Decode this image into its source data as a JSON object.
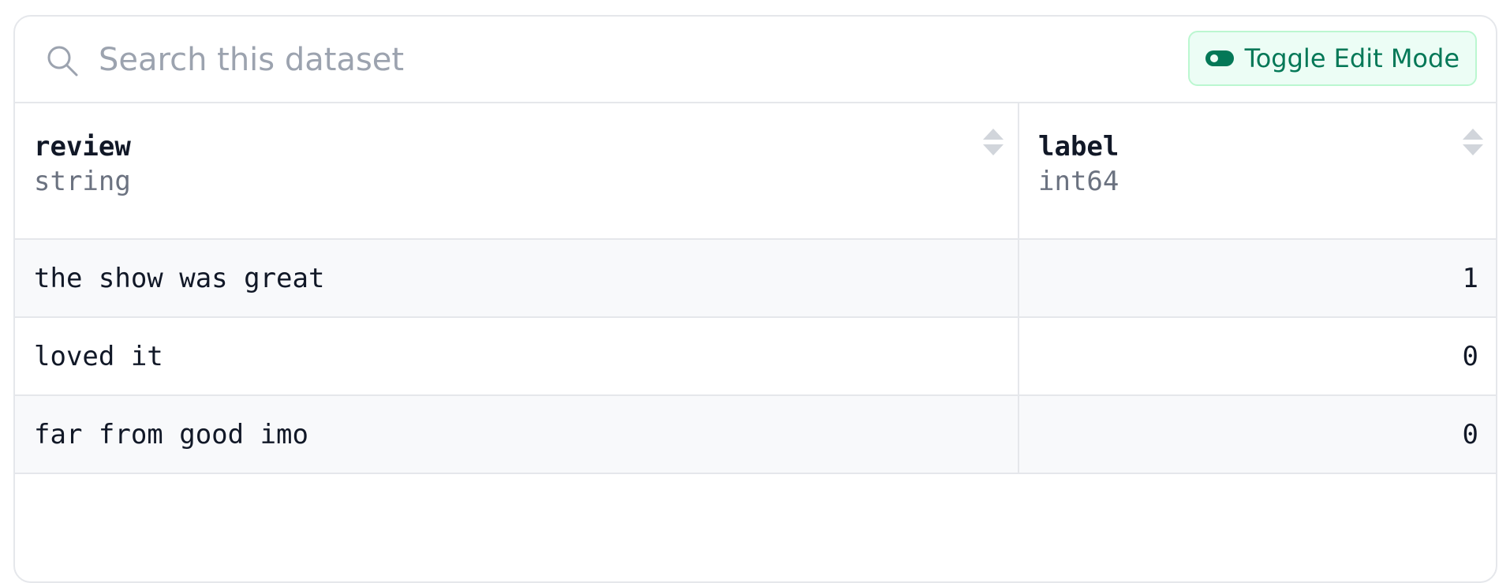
{
  "search": {
    "placeholder": "Search this dataset"
  },
  "toolbar": {
    "toggle_edit_label": "Toggle Edit Mode",
    "accent_color": "#047857"
  },
  "table": {
    "columns": [
      {
        "name": "review",
        "type": "string"
      },
      {
        "name": "label",
        "type": "int64"
      }
    ],
    "rows": [
      {
        "review": "the show was great",
        "label": "1"
      },
      {
        "review": "loved it",
        "label": "0"
      },
      {
        "review": "far from good imo",
        "label": "0"
      }
    ]
  },
  "icons": {
    "search": "search-icon",
    "toggle": "toggle-icon",
    "sort": "sort-icon"
  }
}
